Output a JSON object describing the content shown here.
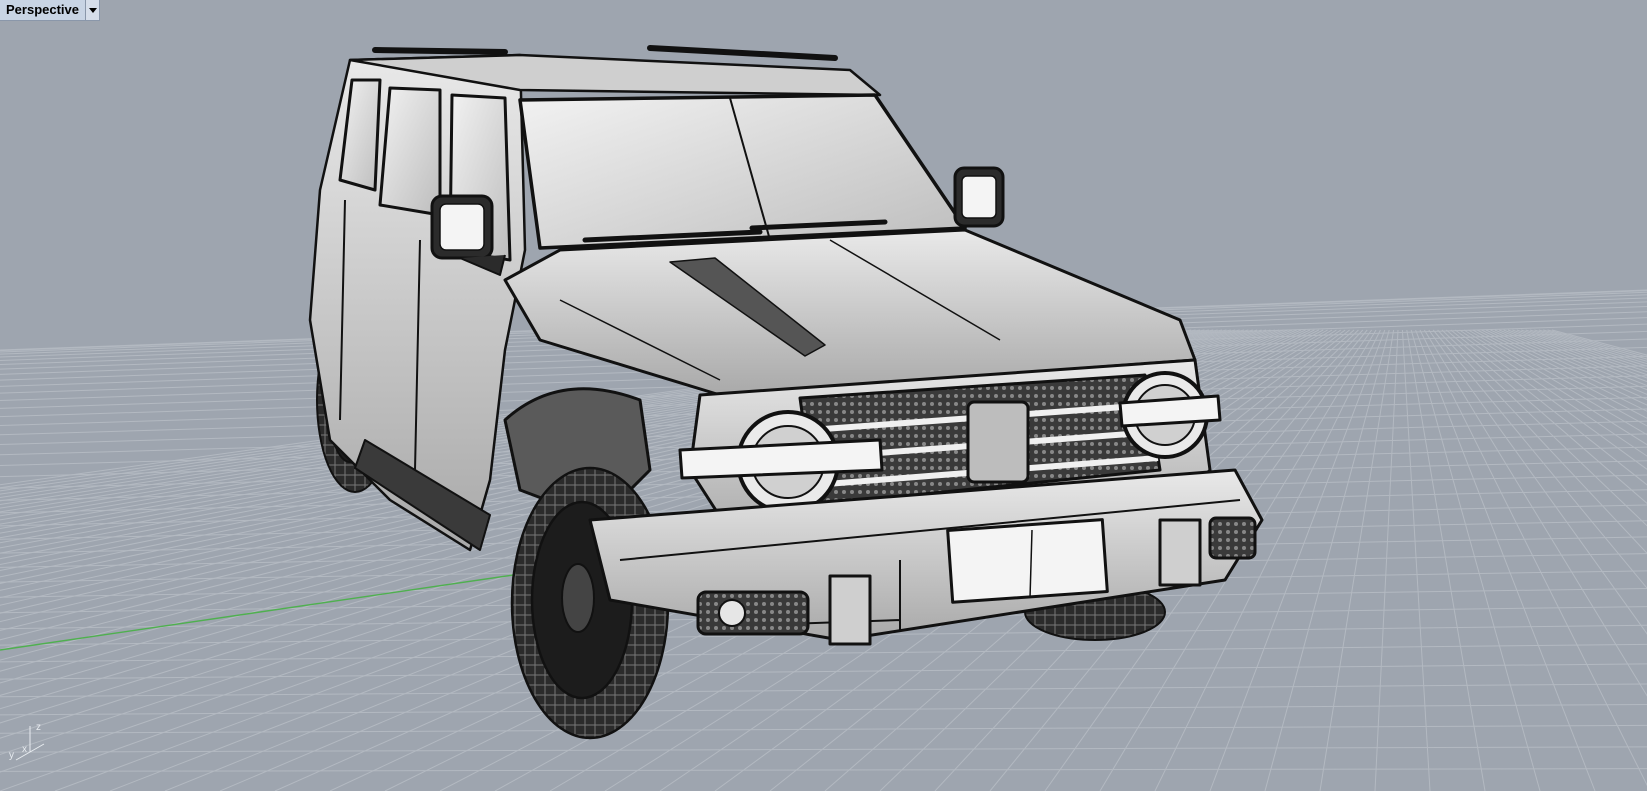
{
  "viewport": {
    "title": "Perspective",
    "menu_icon": "dropdown-triangle-icon"
  },
  "axis_widget": {
    "x_label": "x",
    "y_label": "y",
    "z_label": "z"
  },
  "colors": {
    "background": "#9ea5af",
    "grid": "#b3b9c1",
    "x_axis": "#c26b6b",
    "y_axis": "#4fb04f",
    "wire": "#111111",
    "shaded": "#d5d5d5"
  }
}
